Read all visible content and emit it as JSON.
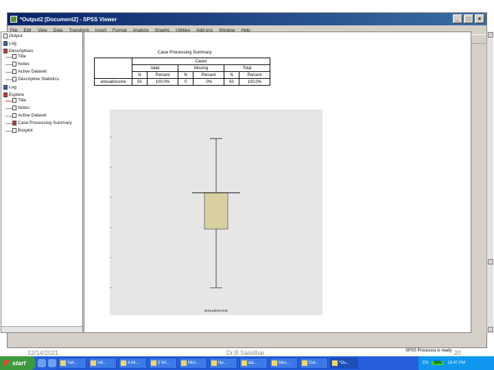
{
  "window": {
    "title": "*Output2 [Document2] - SPSS Viewer"
  },
  "window_controls": {
    "minimize": "_",
    "maximize": "□",
    "close": "×"
  },
  "menubar": [
    "File",
    "Edit",
    "View",
    "Data",
    "Transform",
    "Insert",
    "Format",
    "Analyze",
    "Graphs",
    "Utilities",
    "Add-ons",
    "Window",
    "Help"
  ],
  "outline": {
    "items": [
      {
        "label": "Output",
        "icon": "folder-icon"
      },
      {
        "label": "Log",
        "icon": "log-icon"
      },
      {
        "label": "Descriptives",
        "icon": "book-icon"
      },
      {
        "label": "Title",
        "icon": "title-icon"
      },
      {
        "label": "Notes",
        "icon": "notes-icon"
      },
      {
        "label": "Active Dataset",
        "icon": "dataset-icon"
      },
      {
        "label": "Descriptive Statistics",
        "icon": "table-icon"
      },
      {
        "label": "Log",
        "icon": "log-icon"
      },
      {
        "label": "Explore",
        "icon": "book-icon"
      },
      {
        "label": "Title",
        "icon": "title-icon"
      },
      {
        "label": "Notes",
        "icon": "notes-icon"
      },
      {
        "label": "Active Dataset",
        "icon": "dataset-icon"
      },
      {
        "label": "Case Processing Summary",
        "icon": "table-icon"
      },
      {
        "label": "Boxplot",
        "icon": "chart-icon"
      }
    ]
  },
  "summary": {
    "title": "Case Processing Summary",
    "group": "Cases",
    "subgroups": [
      "Valid",
      "Missing",
      "Total"
    ],
    "cols": [
      "N",
      "Percent",
      "N",
      "Percent",
      "N",
      "Percent"
    ],
    "row_label": "annualincome",
    "row_values": [
      "50",
      "100.0%",
      "0",
      ".0%",
      "50",
      "100.0%"
    ]
  },
  "chart_data": {
    "type": "boxplot",
    "categories": [
      "annualincome"
    ],
    "ylim": [
      190,
      310
    ],
    "yticks": [
      200,
      220,
      240,
      260,
      280,
      300
    ],
    "boxes": [
      {
        "min": 200,
        "q1": 239,
        "median": 263,
        "q3": 262,
        "max": 299
      }
    ],
    "xlabel": "annualincome"
  },
  "footer": {
    "date": "12/14/2021",
    "author": "Dr.B.Sasidhar",
    "page": "20"
  },
  "taskbar": {
    "start": "start",
    "tasks": [
      "Yah...",
      "Inb...",
      "4 Mi...",
      "5 Wi...",
      "Micr...",
      "Ne...",
      "ala...",
      "Micr...",
      "Out...",
      "*Ou..."
    ],
    "spss_status": "SPSS Processor is ready",
    "tray_badge": "99%",
    "time": "10:47 PM"
  }
}
